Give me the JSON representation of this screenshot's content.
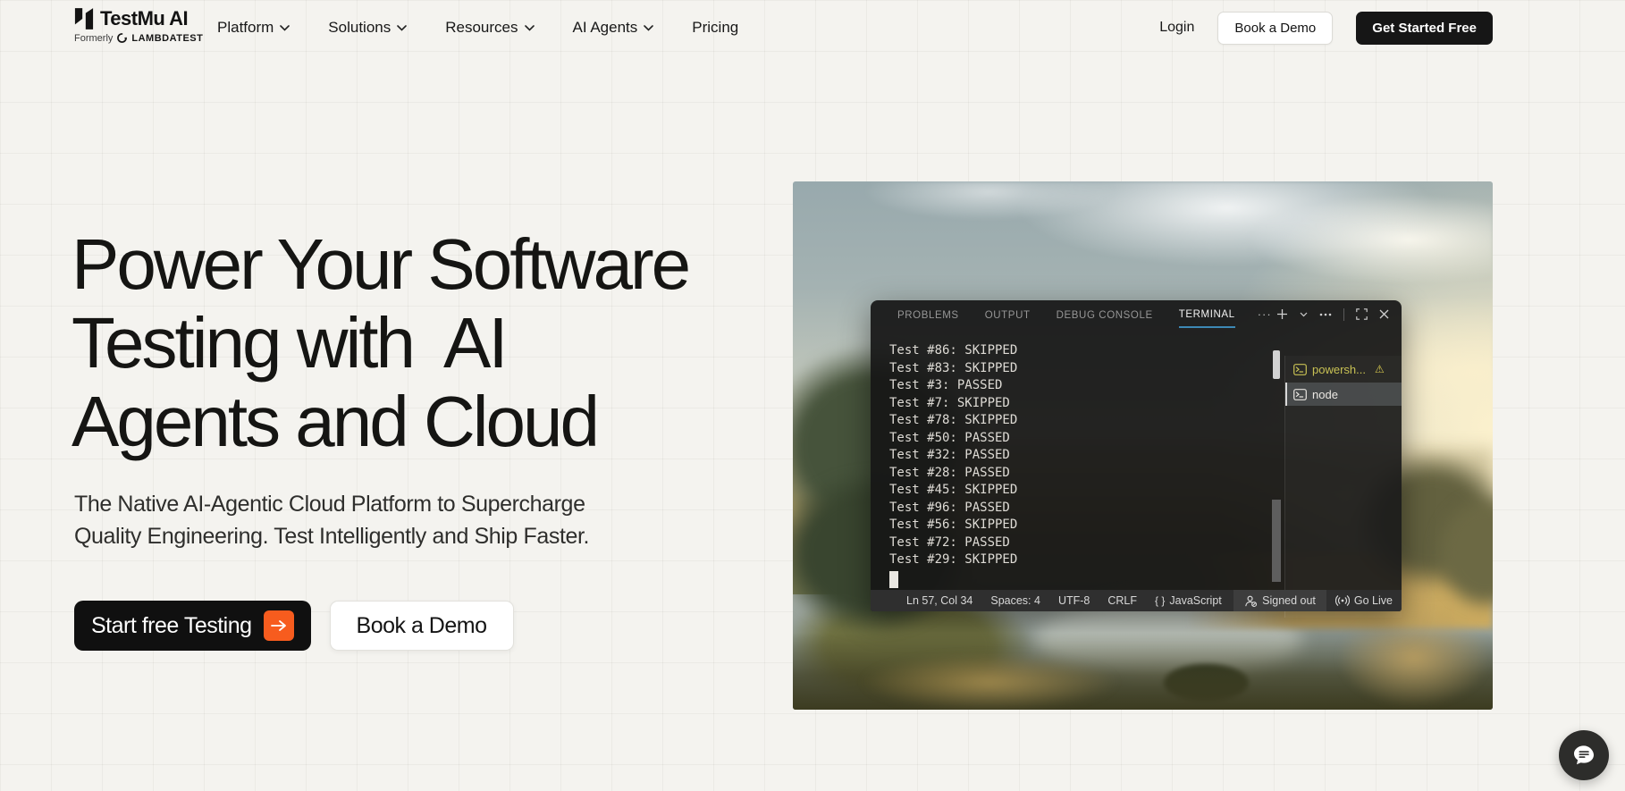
{
  "header": {
    "logo": {
      "title": "TestMu AI",
      "formerly": "Formerly",
      "brand": "LAMBDATEST"
    },
    "nav": [
      {
        "label": "Platform",
        "chevron": true
      },
      {
        "label": "Solutions",
        "chevron": true
      },
      {
        "label": "Resources",
        "chevron": true
      },
      {
        "label": "AI Agents",
        "chevron": true
      },
      {
        "label": "Pricing",
        "chevron": false
      }
    ],
    "actions": {
      "login": "Login",
      "book_demo": "Book a Demo",
      "get_started": "Get Started Free"
    }
  },
  "hero": {
    "headline": "Power Your Software\nTesting with  AI\nAgents and Cloud",
    "subtitle": "The Native AI-Agentic Cloud Platform to Supercharge\nQuality Engineering. Test Intelligently and Ship Faster.",
    "cta_primary": "Start free Testing",
    "cta_secondary": "Book a Demo"
  },
  "terminal": {
    "tabs": [
      "PROBLEMS",
      "OUTPUT",
      "DEBUG CONSOLE",
      "TERMINAL"
    ],
    "active_tab": "TERMINAL",
    "more_tabs_ellipsis": "···",
    "lines": [
      "Test #86: SKIPPED",
      "Test #83: SKIPPED",
      "Test #3: PASSED",
      "Test #7: SKIPPED",
      "Test #78: SKIPPED",
      "Test #50: PASSED",
      "Test #32: PASSED",
      "Test #28: PASSED",
      "Test #45: SKIPPED",
      "Test #96: PASSED",
      "Test #56: SKIPPED",
      "Test #72: PASSED",
      "Test #29: SKIPPED"
    ],
    "sidebar": [
      {
        "name": "powersh...",
        "warning": "⚠"
      },
      {
        "name": "node"
      }
    ],
    "status_bar": {
      "position": "Ln 57, Col 34",
      "spaces": "Spaces: 4",
      "encoding": "UTF-8",
      "eol": "CRLF",
      "braces": "{ }",
      "language": "JavaScript",
      "account": "Signed out",
      "golive": "Go Live"
    }
  },
  "colors": {
    "page_bg": "#f4f3ef",
    "grid_line": "#e7e6e1",
    "accent_orange": "#f75c1e",
    "button_black": "#101010",
    "terminal_bg": "#161615",
    "tab_underline": "#3d88b5",
    "warning_yellow": "#c8c154"
  }
}
